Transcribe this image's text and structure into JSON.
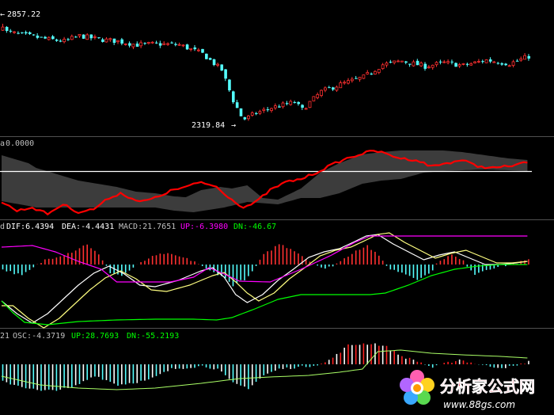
{
  "chart_data": [
    {
      "type": "candlestick",
      "panel": "price",
      "labels": {
        "high_label": "2857.22",
        "low_label": "2319.84"
      },
      "high": 2857.22,
      "low": 2319.84,
      "colors": {
        "up": "#ff3030",
        "down": "#54ffff"
      }
    },
    {
      "type": "area",
      "panel": "band-indicator",
      "header": "0.0000",
      "colors": {
        "band": "#3c3c3c",
        "line": "#ff0000",
        "ref": "#ffffff"
      }
    },
    {
      "type": "bar",
      "panel": "macd",
      "legend": [
        {
          "text": "DIF:6.4394",
          "color": "#ffffff"
        },
        {
          "text": "DEA:-4.4431",
          "color": "#ffffff"
        },
        {
          "text": "MACD:21.7651",
          "color": "#c0c0c0"
        },
        {
          "text": "UP:-6.3980",
          "color": "#ff00ff"
        },
        {
          "text": "DN:-46.67",
          "color": "#00ff00"
        }
      ],
      "prefix": "d",
      "colors": {
        "pos": "#ff3030",
        "neg": "#54ffff",
        "dif": "#ffffff",
        "dea": "#ffff80",
        "up": "#ff00ff",
        "dn": "#00ff00"
      }
    },
    {
      "type": "bar",
      "panel": "osc",
      "legend": [
        {
          "text": "OSC:-4.3719",
          "color": "#c0c0c0"
        },
        {
          "text": "UP:28.7693",
          "color": "#00ff00"
        },
        {
          "text": "DN:-55.2193",
          "color": "#00ff00"
        }
      ],
      "prefix": "21",
      "colors": {
        "pos": "#ff2020",
        "neg": "#54ffff",
        "white": "#ffffff",
        "line": "#aaff66"
      }
    }
  ],
  "watermark": {
    "name": "分析家公式网",
    "url": "www.88gs.com"
  }
}
